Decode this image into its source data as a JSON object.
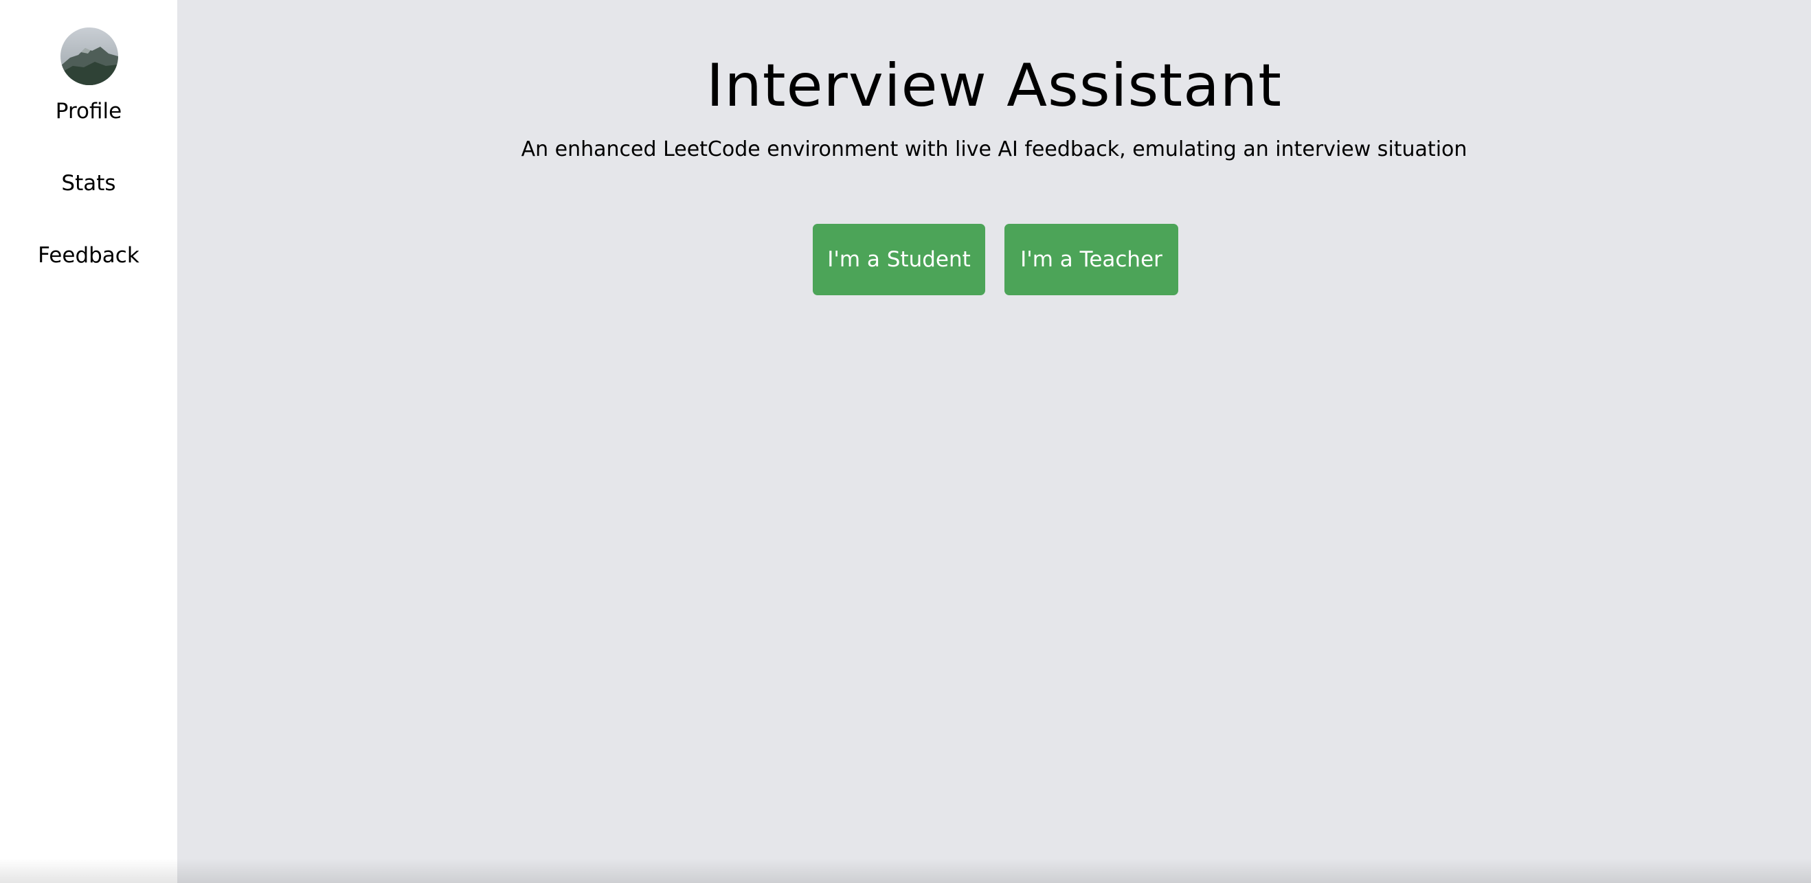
{
  "sidebar": {
    "avatar": "avatar",
    "items": [
      {
        "label": "Profile"
      },
      {
        "label": "Stats"
      },
      {
        "label": "Feedback"
      }
    ]
  },
  "main": {
    "title": "Interview Assistant",
    "subtitle": "An enhanced LeetCode environment with live AI feedback, emulating an interview situation",
    "buttons": [
      {
        "label": "I'm a Student"
      },
      {
        "label": "I'm a Teacher"
      }
    ]
  },
  "colors": {
    "background": "#e5e6ea",
    "sidebar": "#ffffff",
    "button": "#4ca458",
    "button_text": "#ffffff"
  }
}
